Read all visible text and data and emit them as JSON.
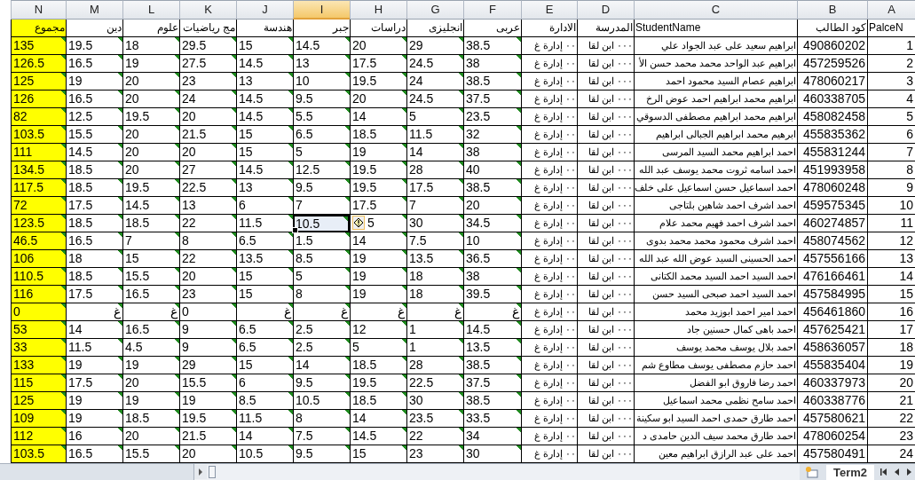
{
  "columns": [
    {
      "letter": "A",
      "title": "PalceN",
      "selected": false,
      "highlight": false,
      "flagged": false,
      "kind": "number"
    },
    {
      "letter": "B",
      "title": "كود الطالب",
      "selected": false,
      "highlight": false,
      "flagged": false,
      "kind": "number"
    },
    {
      "letter": "C",
      "title": "StudentName",
      "selected": false,
      "highlight": false,
      "flagged": false,
      "kind": "text"
    },
    {
      "letter": "D",
      "title": "المدرسة",
      "selected": false,
      "highlight": false,
      "flagged": false,
      "kind": "text"
    },
    {
      "letter": "E",
      "title": "الادارة",
      "selected": false,
      "highlight": false,
      "flagged": false,
      "kind": "text"
    },
    {
      "letter": "F",
      "title": "عربى",
      "selected": false,
      "highlight": false,
      "flagged": true,
      "kind": "text"
    },
    {
      "letter": "G",
      "title": "انجليزى",
      "selected": false,
      "highlight": false,
      "flagged": true,
      "kind": "text"
    },
    {
      "letter": "H",
      "title": "دراسات",
      "selected": false,
      "highlight": false,
      "flagged": true,
      "kind": "text"
    },
    {
      "letter": "I",
      "title": "جبر",
      "selected": true,
      "highlight": false,
      "flagged": true,
      "kind": "text"
    },
    {
      "letter": "J",
      "title": "هندسة",
      "selected": false,
      "highlight": false,
      "flagged": true,
      "kind": "text"
    },
    {
      "letter": "K",
      "title": "مج رياضيات",
      "selected": false,
      "highlight": false,
      "flagged": true,
      "kind": "text"
    },
    {
      "letter": "L",
      "title": "علوم",
      "selected": false,
      "highlight": false,
      "flagged": true,
      "kind": "text"
    },
    {
      "letter": "M",
      "title": "دين",
      "selected": false,
      "highlight": false,
      "flagged": true,
      "kind": "text"
    },
    {
      "letter": "N",
      "title": "مجموع",
      "selected": false,
      "highlight": true,
      "flagged": true,
      "kind": "text"
    }
  ],
  "rows": [
    {
      "selected": false,
      "warning": false,
      "cells": [
        "1",
        "490860202",
        "ابراهيم سعيد على عبد الجواد علي",
        "٠٠٠ ابن لقا",
        "٠٠ إدارة غ",
        "38.5",
        "29",
        "20",
        "14.5",
        "15",
        "29.5",
        "18",
        "19.5",
        "135"
      ]
    },
    {
      "selected": false,
      "warning": false,
      "cells": [
        "2",
        "457259526",
        "ابراهيم عبد الواحد محمد محمد حسن الأ",
        "٠٠٠ ابن لقا",
        "٠٠ إدارة غ",
        "38",
        "24.5",
        "17.5",
        "13",
        "14.5",
        "27.5",
        "19",
        "16.5",
        "126.5"
      ]
    },
    {
      "selected": false,
      "warning": false,
      "cells": [
        "3",
        "478060217",
        "ابراهيم عصام السيد محمود احمد",
        "٠٠٠ ابن لقا",
        "٠٠ إدارة غ",
        "38.5",
        "24",
        "19.5",
        "10",
        "13",
        "23",
        "20",
        "19",
        "125"
      ]
    },
    {
      "selected": false,
      "warning": false,
      "cells": [
        "4",
        "460338705",
        "ابراهيم محمد ابراهيم احمد عوض الرخ",
        "٠٠٠ ابن لقا",
        "٠٠ إدارة غ",
        "37.5",
        "24.5",
        "20",
        "9.5",
        "14.5",
        "24",
        "20",
        "16.5",
        "126"
      ]
    },
    {
      "selected": false,
      "warning": false,
      "cells": [
        "5",
        "458082458",
        "ابراهيم محمد ابراهيم مصطفى الدسوقي",
        "٠٠٠ ابن لقا",
        "٠٠ إدارة غ",
        "23.5",
        "5",
        "14",
        "5.5",
        "14.5",
        "20",
        "19.5",
        "12.5",
        "82"
      ]
    },
    {
      "selected": false,
      "warning": false,
      "cells": [
        "6",
        "455835362",
        "ابرهيم محمد ابراهيم الجبالى ابراهيم",
        "٠٠٠ ابن لقا",
        "٠٠ إدارة غ",
        "32",
        "11.5",
        "18.5",
        "6.5",
        "15",
        "21.5",
        "20",
        "15.5",
        "103.5"
      ]
    },
    {
      "selected": false,
      "warning": false,
      "cells": [
        "7",
        "455831244",
        "احمد ابراهيم محمد السيد المرسى",
        "٠٠٠ ابن لقا",
        "٠٠ إدارة غ",
        "38",
        "14",
        "19",
        "5",
        "15",
        "20",
        "20",
        "14.5",
        "111"
      ]
    },
    {
      "selected": false,
      "warning": false,
      "cells": [
        "8",
        "451993958",
        "احمد اسامه ثروت محمد يوسف عبد الله",
        "٠٠٠ ابن لقا",
        "٠٠ إدارة غ",
        "40",
        "28",
        "19.5",
        "12.5",
        "14.5",
        "27",
        "20",
        "18.5",
        "134.5"
      ]
    },
    {
      "selected": false,
      "warning": false,
      "cells": [
        "9",
        "478060248",
        "احمد اسماعيل حسن اسماعيل على خلف",
        "٠٠٠ ابن لقا",
        "٠٠ إدارة غ",
        "38.5",
        "17.5",
        "19.5",
        "9.5",
        "13",
        "22.5",
        "19.5",
        "18.5",
        "117.5"
      ]
    },
    {
      "selected": false,
      "warning": false,
      "cells": [
        "10",
        "459575345",
        "احمد اشرف احمد شاهين بلتاجى",
        "٠٠٠ ابن لقا",
        "٠٠ إدارة غ",
        "20",
        "7",
        "17.5",
        "7",
        "6",
        "13",
        "14.5",
        "17.5",
        "72"
      ]
    },
    {
      "selected": true,
      "warning": true,
      "cells": [
        "11",
        "460274857",
        "احمد اشرف احمد فهيم محمد علام",
        "٠٠٠ ابن لقا",
        "٠٠ إدارة غ",
        "34.5",
        "30",
        "5",
        "10.5",
        "11.5",
        "22",
        "18.5",
        "18.5",
        "123.5"
      ]
    },
    {
      "selected": false,
      "warning": false,
      "cells": [
        "12",
        "458074562",
        "احمد اشرف محمود محمد محمد بدوى",
        "٠٠٠ ابن لقا",
        "٠٠ إدارة غ",
        "10",
        "7.5",
        "14",
        "1.5",
        "6.5",
        "8",
        "7",
        "16.5",
        "46.5"
      ]
    },
    {
      "selected": false,
      "warning": false,
      "cells": [
        "13",
        "457556166",
        "احمد الحسينى السيد عوض الله عبد الله",
        "٠٠٠ ابن لقا",
        "٠٠ إدارة غ",
        "36.5",
        "13.5",
        "19",
        "8.5",
        "13.5",
        "22",
        "15",
        "18",
        "106"
      ]
    },
    {
      "selected": false,
      "warning": false,
      "cells": [
        "14",
        "476166461",
        "احمد السيد احمد السيد محمد الكتانى",
        "٠٠٠ ابن لقا",
        "٠٠ إدارة غ",
        "38",
        "18",
        "19",
        "5",
        "15",
        "20",
        "15.5",
        "18.5",
        "110.5"
      ]
    },
    {
      "selected": false,
      "warning": false,
      "cells": [
        "15",
        "457584995",
        "احمد السيد احمد صبحى السيد حسن",
        "٠٠٠ ابن لقا",
        "٠٠ إدارة غ",
        "39.5",
        "18",
        "19",
        "8",
        "15",
        "23",
        "16.5",
        "17.5",
        "116"
      ]
    },
    {
      "selected": false,
      "warning": false,
      "cells": [
        "16",
        "456461860",
        "احمد امير احمد ابوزيد محمد",
        "٠٠٠ ابن لقا",
        "٠٠ إدارة غ",
        "غ",
        "غ",
        "غ",
        "غ",
        "غ",
        "0",
        "غ",
        "غ",
        "0"
      ]
    },
    {
      "selected": false,
      "warning": false,
      "cells": [
        "17",
        "457625421",
        "احمد باهى كمال حسنين جاد",
        "٠٠٠ ابن لقا",
        "٠٠ إدارة غ",
        "14.5",
        "1",
        "12",
        "2.5",
        "6.5",
        "9",
        "16.5",
        "14",
        "53"
      ]
    },
    {
      "selected": false,
      "warning": false,
      "cells": [
        "18",
        "458636057",
        "احمد بلال يوسف محمد يوسف",
        "٠٠٠ ابن لقا",
        "٠٠ إدارة غ",
        "13.5",
        "1",
        "5",
        "2.5",
        "6.5",
        "9",
        "4.5",
        "11.5",
        "33"
      ]
    },
    {
      "selected": false,
      "warning": false,
      "cells": [
        "19",
        "455835404",
        "احمد حازم مصطفى يوسف مطاوع شم",
        "٠٠٠ ابن لقا",
        "٠٠ إدارة غ",
        "38.5",
        "28",
        "18.5",
        "14",
        "15",
        "29",
        "19",
        "19",
        "133"
      ]
    },
    {
      "selected": false,
      "warning": false,
      "cells": [
        "20",
        "460337973",
        "احمد رضا فاروق ابو الفضل",
        "٠٠٠ ابن لقا",
        "٠٠ إدارة غ",
        "37.5",
        "22.5",
        "19.5",
        "9.5",
        "6",
        "15.5",
        "20",
        "17.5",
        "115"
      ]
    },
    {
      "selected": false,
      "warning": false,
      "cells": [
        "21",
        "460338776",
        "احمد سامح نظمى محمد اسماعيل",
        "٠٠٠ ابن لقا",
        "٠٠ إدارة غ",
        "38.5",
        "30",
        "18.5",
        "10.5",
        "8.5",
        "19",
        "19",
        "19",
        "125"
      ]
    },
    {
      "selected": false,
      "warning": false,
      "cells": [
        "22",
        "457580621",
        "احمد طارق حمدى احمد السيد ابو سكينة",
        "٠٠٠ ابن لقا",
        "٠٠ إدارة غ",
        "33.5",
        "23.5",
        "14",
        "8",
        "11.5",
        "19.5",
        "18.5",
        "19",
        "109"
      ]
    },
    {
      "selected": false,
      "warning": false,
      "cells": [
        "23",
        "478060254",
        "احمد طارق محمد سيف الدين حامدى د",
        "٠٠٠ ابن لقا",
        "٠٠ إدارة غ",
        "34",
        "22",
        "14.5",
        "7.5",
        "14",
        "21.5",
        "20",
        "16",
        "112"
      ]
    },
    {
      "selected": false,
      "warning": false,
      "cells": [
        "24",
        "457580491",
        "احمد على عبد الرازق ابراهيم معين",
        "٠٠٠ ابن لقا",
        "٠٠ إدارة غ",
        "30",
        "23",
        "15",
        "9.5",
        "10.5",
        "20",
        "15.5",
        "16.5",
        "103.5"
      ]
    }
  ],
  "sheet_tabs": [
    {
      "label": "Term2",
      "selected": true
    }
  ]
}
